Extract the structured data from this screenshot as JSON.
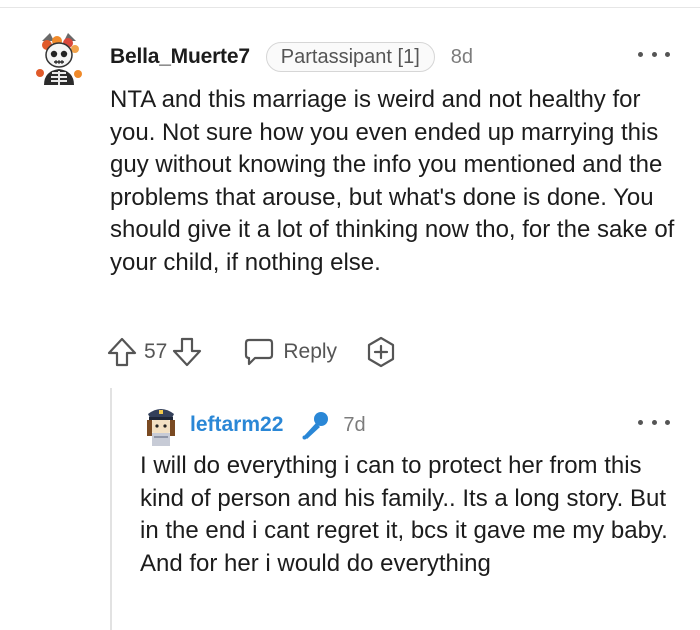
{
  "comment": {
    "author": "Bella_Muerte7",
    "flair": "Partassipant [1]",
    "time": "8d",
    "body": "NTA and this marriage is weird and not healthy for you. Not sure how you even ended up marrying this guy without knowing the info you mentioned and the problems that arouse, but what's done is done. You should give it a lot of thinking now tho, for the sake of your child, if nothing else.",
    "votes": "57",
    "reply_label": "Reply",
    "icons": {
      "upvote": "arrow-up-icon",
      "downvote": "arrow-down-icon",
      "reply": "speech-bubble-icon",
      "award": "plus-hexagon-icon",
      "more": "more-dots-icon"
    }
  },
  "reply": {
    "author": "leftarm22",
    "time": "7d",
    "body": "I will do everything i can to protect her from this kind of person and his family.. Its a long story. But in the end i cant regret it, bcs it gave me my baby. And for her i would do everything",
    "icons": {
      "op_badge": "microphone-icon",
      "more": "more-dots-icon"
    }
  },
  "colors": {
    "reply_author": "#2a87d6",
    "mic_badge": "#2a87d6",
    "muted_text": "#7c7c7c"
  }
}
